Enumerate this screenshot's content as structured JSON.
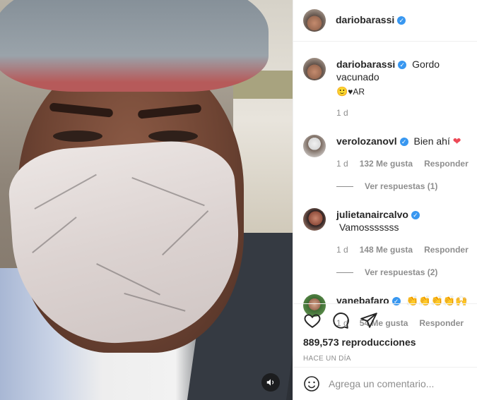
{
  "post": {
    "author": "dariobarassi",
    "sound_icon": "speaker-icon"
  },
  "caption": {
    "author": "dariobarassi",
    "text": "Gordo vacunado",
    "emojis": "🙂",
    "flag": "♥AR",
    "time": "1 d"
  },
  "comments": [
    {
      "author": "verolozanovl",
      "text": "Bien ahí",
      "emoji": "❤",
      "time": "1 d",
      "likes": "132 Me gusta",
      "reply": "Responder",
      "view_replies": "Ver respuestas (1)"
    },
    {
      "author": "julietanaircalvo",
      "text": "Vamosssssss",
      "time": "1 d",
      "likes": "148 Me gusta",
      "reply": "Responder",
      "view_replies": "Ver respuestas (2)"
    },
    {
      "author": "vanebafaro",
      "text": "👏👏👏👏🙌",
      "time": "1 d",
      "likes": "54 Me gusta",
      "reply": "Responder"
    }
  ],
  "stats": {
    "views": "889,573 reproducciones",
    "posted": "HACE UN DÍA"
  },
  "composer": {
    "placeholder": "Agrega un comentario..."
  },
  "icons": [
    "heart-icon",
    "comment-icon",
    "share-icon",
    "emoji-icon",
    "verified-badge-icon"
  ],
  "colors": {
    "verified": "#3897f0",
    "heart": "#ed4956",
    "muted": "#8e8e8e"
  }
}
